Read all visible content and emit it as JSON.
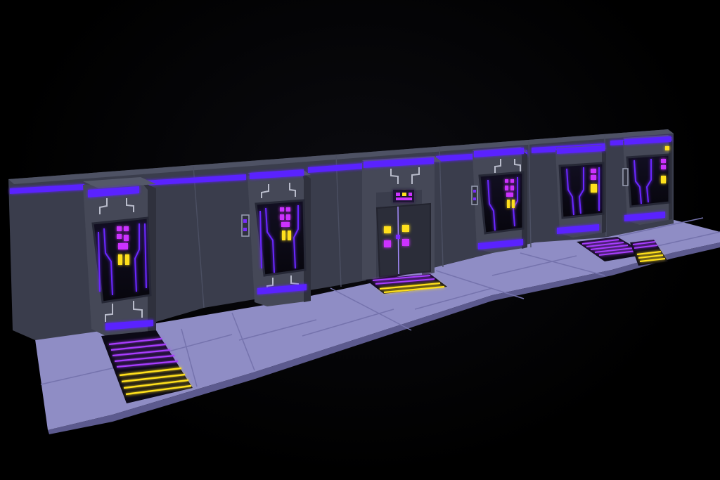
{
  "scene": {
    "background": "#000000",
    "palette": {
      "wall": "#3a3d4c",
      "wall_shade": "#2c2e3a",
      "wall_panel_seam": "#4a4e60",
      "floor": "#8e8cc4",
      "floor_light": "#a7a5d6",
      "floor_edge": "#6a68a0",
      "pillar": "#454857",
      "pillar_dark": "#2e303c",
      "chamber_glass": "#0d0c18",
      "neon_blue": "#5a22ff",
      "neon_violet": "#7a2cff",
      "neon_magenta": "#cc33ff",
      "neon_yellow": "#ffe01a",
      "trace_grey": "#b9bccb"
    },
    "modules": [
      {
        "kind": "cryo-pod",
        "has_floor_grate": true
      },
      {
        "kind": "cryo-pod",
        "has_floor_grate": false
      },
      {
        "kind": "sliding-door",
        "has_floor_grate": true
      },
      {
        "kind": "cryo-pod",
        "has_floor_grate": false
      },
      {
        "kind": "cryo-pod",
        "has_floor_grate": true
      },
      {
        "kind": "cryo-pod",
        "has_floor_grate": true
      }
    ]
  }
}
